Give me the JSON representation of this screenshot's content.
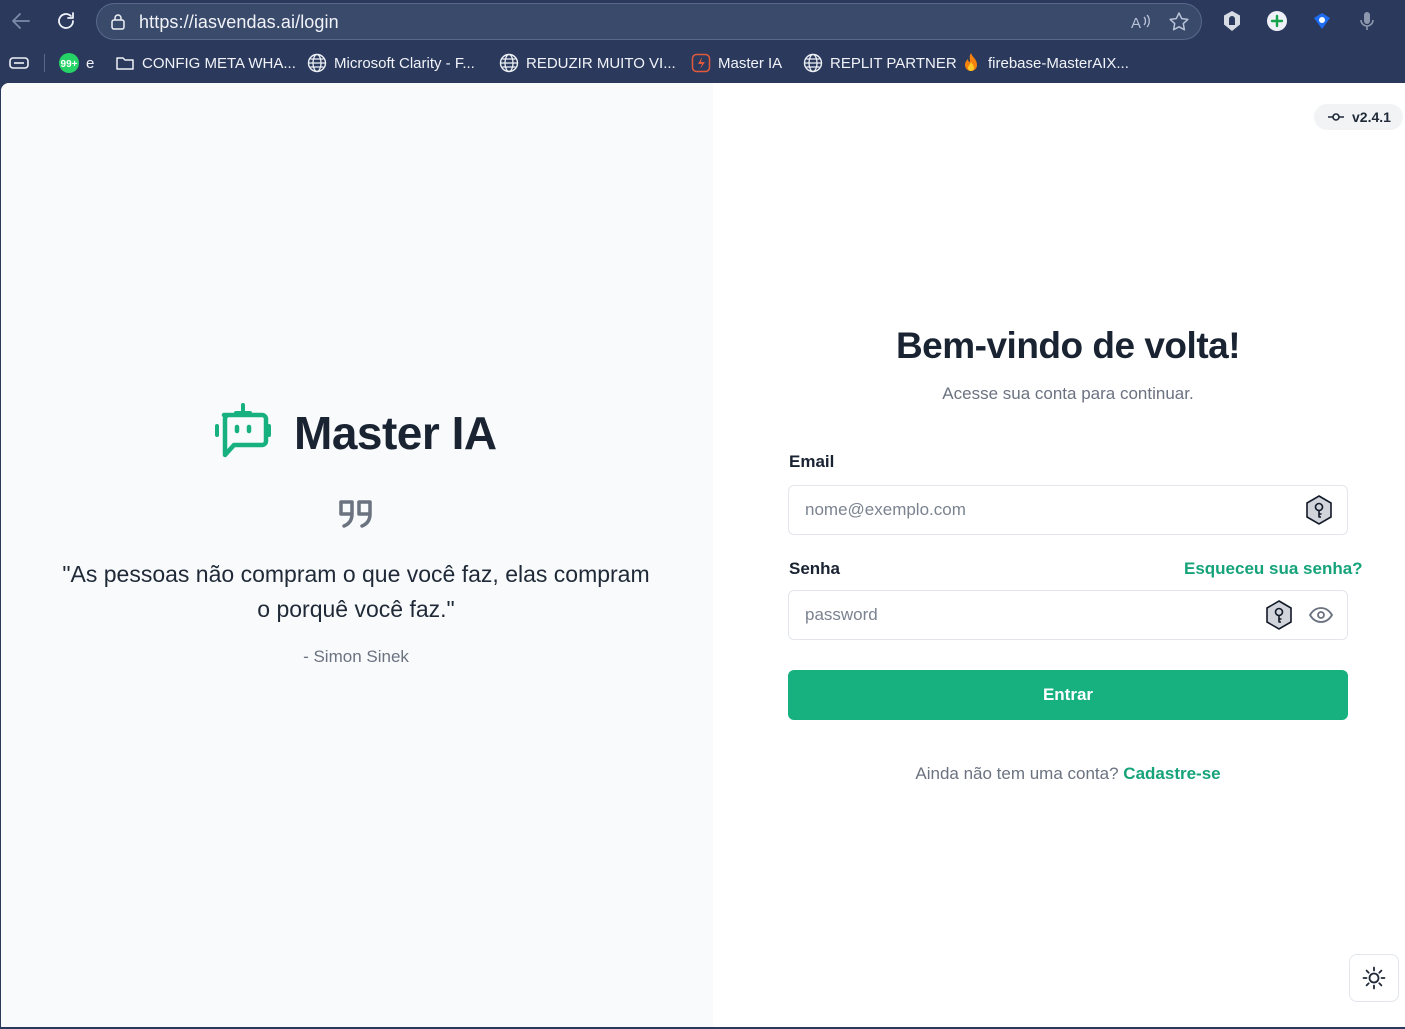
{
  "browser": {
    "url": "https://iasvendas.ai/login",
    "bookmarks": [
      {
        "label": "e",
        "icon": "whatsapp-badge-icon",
        "badge": "99+"
      },
      {
        "label": "CONFIG META WHA...",
        "icon": "folder-icon"
      },
      {
        "label": "Microsoft Clarity - F...",
        "icon": "globe-icon"
      },
      {
        "label": "REDUZIR MUITO VI...",
        "icon": "globe-icon"
      },
      {
        "label": "Master IA",
        "icon": "master-ia-favicon-icon"
      },
      {
        "label": "REPLIT PARTNER",
        "icon": "globe-icon"
      },
      {
        "label": "firebase-MasterAIX...",
        "icon": "firebase-flame-icon"
      }
    ]
  },
  "left": {
    "brand_name": "Master IA",
    "quote": "\"As pessoas não compram o que você faz, elas compram o porquê você faz.\"",
    "author": "- Simon Sinek"
  },
  "version": "v2.4.1",
  "login": {
    "title": "Bem-vindo de volta!",
    "subtitle": "Acesse sua conta para continuar.",
    "email_label": "Email",
    "email_placeholder": "nome@exemplo.com",
    "password_label": "Senha",
    "forgot_link": "Esqueceu sua senha?",
    "password_placeholder": "password",
    "submit_label": "Entrar",
    "signup_prompt": "Ainda não tem uma conta?",
    "signup_link": "Cadastre-se"
  },
  "colors": {
    "brand_green": "#16b17e",
    "link_green": "#16a37a",
    "heading": "#1a2332",
    "browser_chrome": "#2b3a5c"
  }
}
